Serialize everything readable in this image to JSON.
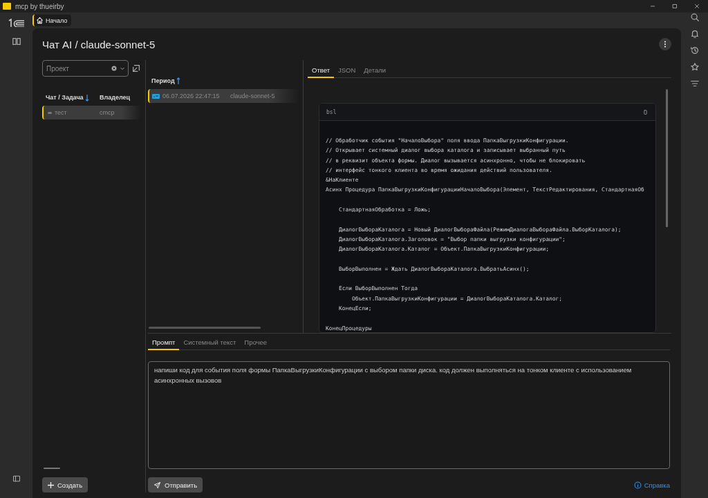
{
  "window": {
    "title": "mcp by thueirby"
  },
  "home_tab": {
    "label": "Начало",
    "selected": true
  },
  "page": {
    "title": "Чат AI / claude-sonnet-5"
  },
  "project_field": {
    "placeholder": "Проект"
  },
  "chats": {
    "columns": [
      {
        "label": "Чат / Задача",
        "sort_ascending": false
      },
      {
        "label": "Владелец"
      }
    ],
    "rows": [
      {
        "cells": [
          "тест",
          "cmcp"
        ],
        "selected": true
      }
    ]
  },
  "requests": {
    "columns": [
      {
        "label": "Период",
        "sort_ascending": true
      }
    ],
    "rows": [
      {
        "cells": [
          "06.07.2026 22:47:15",
          "claude-sonnet-5"
        ],
        "selected": true
      }
    ]
  },
  "response_tabs": [
    {
      "label": "Ответ",
      "selected": true
    },
    {
      "label": "JSON",
      "selected": false
    },
    {
      "label": "Детали",
      "selected": false
    }
  ],
  "code": {
    "language": "bsl",
    "text": "// Обработчик события \"НачалоВыбора\" поля ввода ПапкаВыгрузкиКонфигурации.\n// Открывает системный диалог выбора каталога и записывает выбранный путь\n// в реквизит объекта формы. Диалог вызывается асинхронно, чтобы не блокировать\n// интерфейс тонкого клиента во время ожидания действий пользователя.\n&НаКлиенте\nАсинх Процедура ПапкаВыгрузкиКонфигурацииНачалоВыбора(Элемент, ТекстРедактирования, СтандартнаяОб\n\n    СтандартнаяОбработка = Ложь;\n\n    ДиалогВыбораКаталога = Новый ДиалогВыбораФайла(РежимДиалогаВыбораФайла.ВыборКаталога);\n    ДиалогВыбораКаталога.Заголовок = \"Выбор папки выгрузки конфигурации\";\n    ДиалогВыбораКаталога.Каталог = Объект.ПапкаВыгрузкиКонфигурации;\n\n    ВыборВыполнен = Ждать ДиалогВыбораКаталога.ВыбратьАсинх();\n\n    Если ВыборВыполнен Тогда\n        Объект.ПапкаВыгрузкиКонфигурации = ДиалогВыбораКаталога.Каталог;\n    КонецЕсли;\n\nКонецПроцедуры"
  },
  "prompt_tabs": [
    {
      "label": "Промпт",
      "selected": true
    },
    {
      "label": "Системный текст",
      "selected": false
    },
    {
      "label": "Прочее",
      "selected": false
    }
  ],
  "prompt": {
    "value": "напиши код для события поля формы ПапкаВыгрузкиКонфигурации с выбором папки диска. код должен выполняться на тонком клиенте с использованием асинхронных вызовов"
  },
  "buttons": {
    "create": "Создать",
    "send": "Отправить",
    "help": "Справка"
  }
}
